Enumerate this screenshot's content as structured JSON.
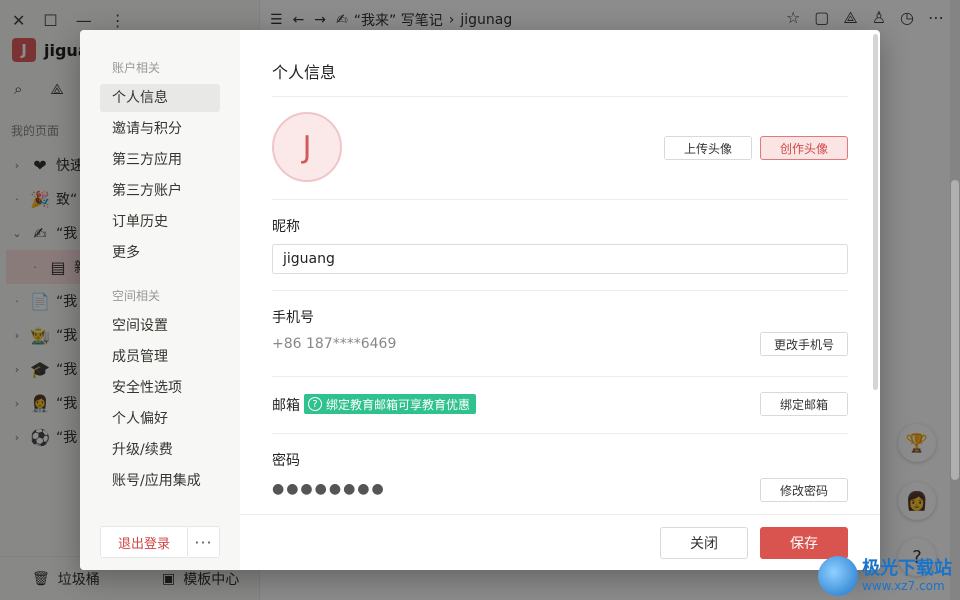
{
  "app": {
    "workspace_initial": "J",
    "workspace_name": "jiguang",
    "my_pages": "我的页面",
    "tree": [
      {
        "arrow": "›",
        "emoji": "❤",
        "label": "快速"
      },
      {
        "arrow": "·",
        "emoji": "🎉",
        "label": "致“"
      },
      {
        "arrow": "⌄",
        "emoji": "✍",
        "label": "“我"
      },
      {
        "arrow": "·",
        "emoji": "▤",
        "label": "新",
        "active": true
      },
      {
        "arrow": "·",
        "emoji": "📄",
        "label": "“我"
      },
      {
        "arrow": "›",
        "emoji": "👨‍🌾",
        "label": "“我"
      },
      {
        "arrow": "›",
        "emoji": "🎓",
        "label": "“我"
      },
      {
        "arrow": "›",
        "emoji": "👩‍⚕",
        "label": "“我"
      },
      {
        "arrow": "›",
        "emoji": "⚽",
        "label": "“我"
      }
    ],
    "trash": "垃圾桶",
    "templates": "模板中心",
    "breadcrumb_page": "“我来” 写笔记",
    "breadcrumb_sub": "jigunag"
  },
  "modal": {
    "nav": {
      "group_account": "账户相关",
      "account_items": [
        "个人信息",
        "邀请与积分",
        "第三方应用",
        "第三方账户",
        "订单历史",
        "更多"
      ],
      "group_space": "空间相关",
      "space_items": [
        "空间设置",
        "成员管理",
        "安全性选项",
        "个人偏好",
        "升级/续费",
        "账号/应用集成"
      ],
      "logout": "退出登录",
      "more": "···"
    },
    "content": {
      "title": "个人信息",
      "avatar_initial": "J",
      "upload_avatar": "上传头像",
      "create_avatar": "创作头像",
      "nickname_label": "昵称",
      "nickname_value": "jiguang",
      "phone_label": "手机号",
      "phone_value": "+86 187****6469",
      "change_phone": "更改手机号",
      "email_label": "邮箱",
      "email_badge": "绑定教育邮箱可享教育优惠",
      "bind_email": "绑定邮箱",
      "password_label": "密码",
      "password_value": "●●●●●●●●",
      "change_password": "修改密码"
    },
    "footer": {
      "close": "关闭",
      "save": "保存"
    }
  },
  "watermark": {
    "name": "极光下载站",
    "url": "www.xz7.com"
  },
  "colors": {
    "accent": "#d9534f",
    "badge": "#2fc28e"
  }
}
